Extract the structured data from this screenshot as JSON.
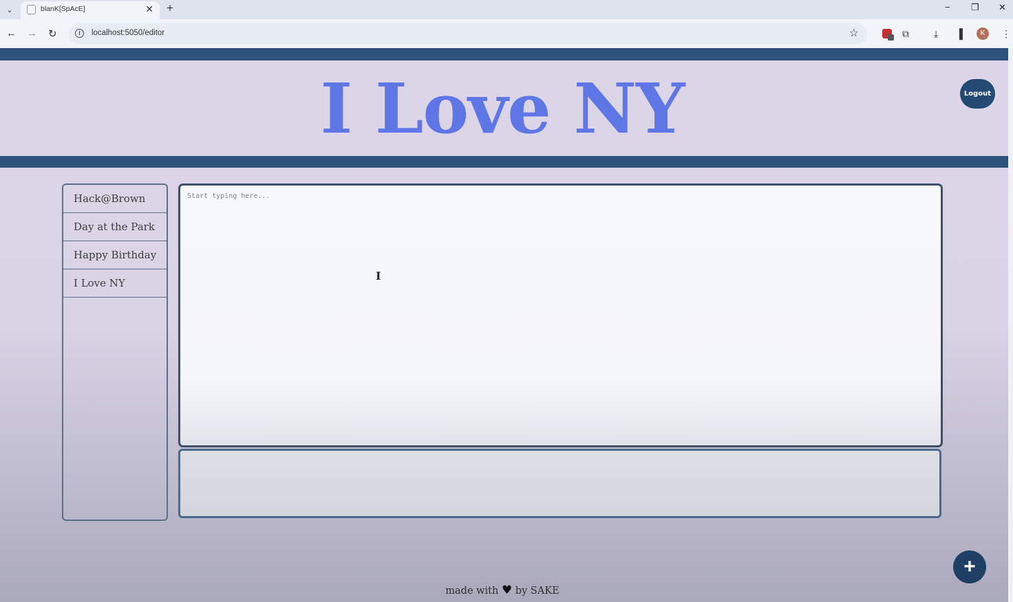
{
  "browser": {
    "tab": {
      "title": "blanK[SpAcE]",
      "close_label": "✕"
    },
    "new_tab_label": "+",
    "window_controls": {
      "minimize": "−",
      "restore": "❐",
      "close": "✕"
    },
    "nav": {
      "back": "←",
      "forward": "→",
      "reload": "↻"
    },
    "url": "localhost:5050/editor",
    "profile_initial": "K",
    "tab_list_label": "⌄"
  },
  "header": {
    "title": "I Love NY",
    "logout_label": "Logout"
  },
  "sidebar": {
    "items": [
      {
        "label": "Hack@Brown"
      },
      {
        "label": "Day at the Park"
      },
      {
        "label": "Happy Birthday"
      },
      {
        "label": "I Love NY"
      }
    ]
  },
  "editor": {
    "placeholder": "Start typing here...",
    "value": ""
  },
  "fab": {
    "label": "+"
  },
  "footer": {
    "prefix": "made with",
    "heart": "♥",
    "suffix": "by SAKE"
  },
  "colors": {
    "band": "#2d527c",
    "title": "#5f77e6",
    "button": "#234a73"
  }
}
